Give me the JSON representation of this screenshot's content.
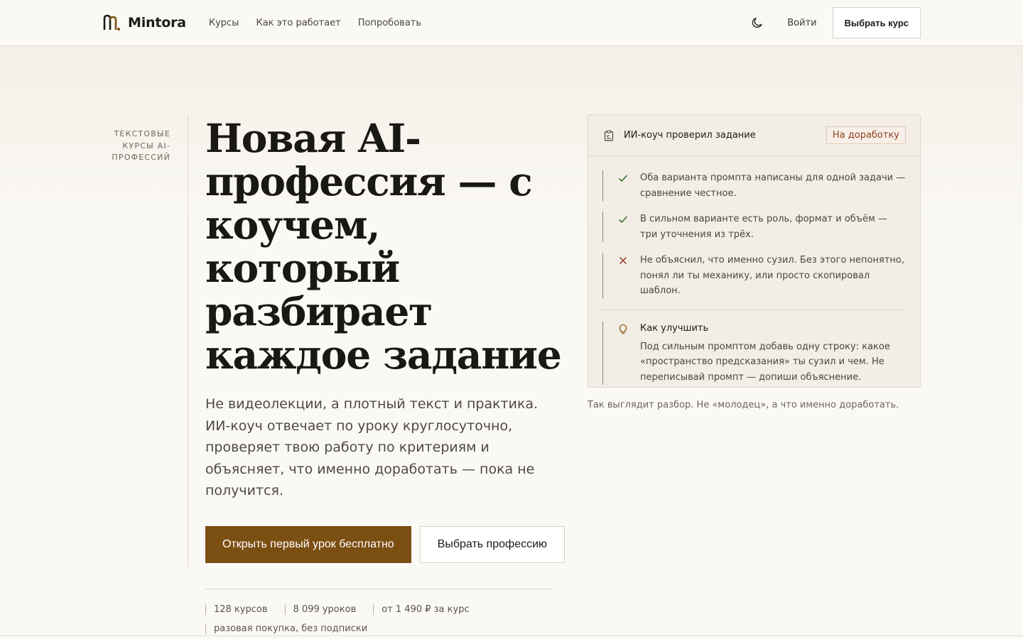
{
  "header": {
    "brand": "Mintora",
    "nav": [
      "Курсы",
      "Как это работает",
      "Попробовать"
    ],
    "login": "Войти",
    "choose_course": "Выбрать курс"
  },
  "rail": {
    "label": "Текстовые курсы AI-профессий"
  },
  "hero": {
    "title": "Новая AI-профессия — с коучем, который разбирает каждое задание",
    "subtitle": "Не видеолекции, а плотный текст и практика. ИИ-коуч отвечает по уроку круглосуточно, проверяет твою работу по критериям и объясняет, что именно доработать — пока не получится.",
    "cta_primary": "Открыть первый урок бесплатно",
    "cta_secondary": "Выбрать профессию",
    "stats": [
      "128 курсов",
      "8 099 уроков",
      "от 1 490 ₽ за курс",
      "разовая покупка, без подписки"
    ]
  },
  "card": {
    "title": "ИИ-коуч проверил задание",
    "badge": "На доработку",
    "checks": [
      {
        "status": "ok",
        "text": "Оба варианта промпта написаны для одной задачи — сравнение честное."
      },
      {
        "status": "ok",
        "text": "В сильном варианте есть роль, формат и объём — три уточнения из трёх."
      },
      {
        "status": "fail",
        "text": "Не объяснил, что именно сузил. Без этого непонятно, понял ли ты механику, или просто скопировал шаблон."
      }
    ],
    "improve_title": "Как улучшить",
    "improve_text": "Под сильным промптом добавь одну строку: какое «пространство предсказания» ты сузил и чем. Не переписывай промпт — допиши объяснение.",
    "caption": "Так выглядит разбор. Не «молодец», а что именно доработать."
  },
  "colors": {
    "accent": "#7b4e12",
    "ok": "#3d6b2e",
    "fail": "#9b3a22",
    "bulb": "#8a5a14"
  }
}
